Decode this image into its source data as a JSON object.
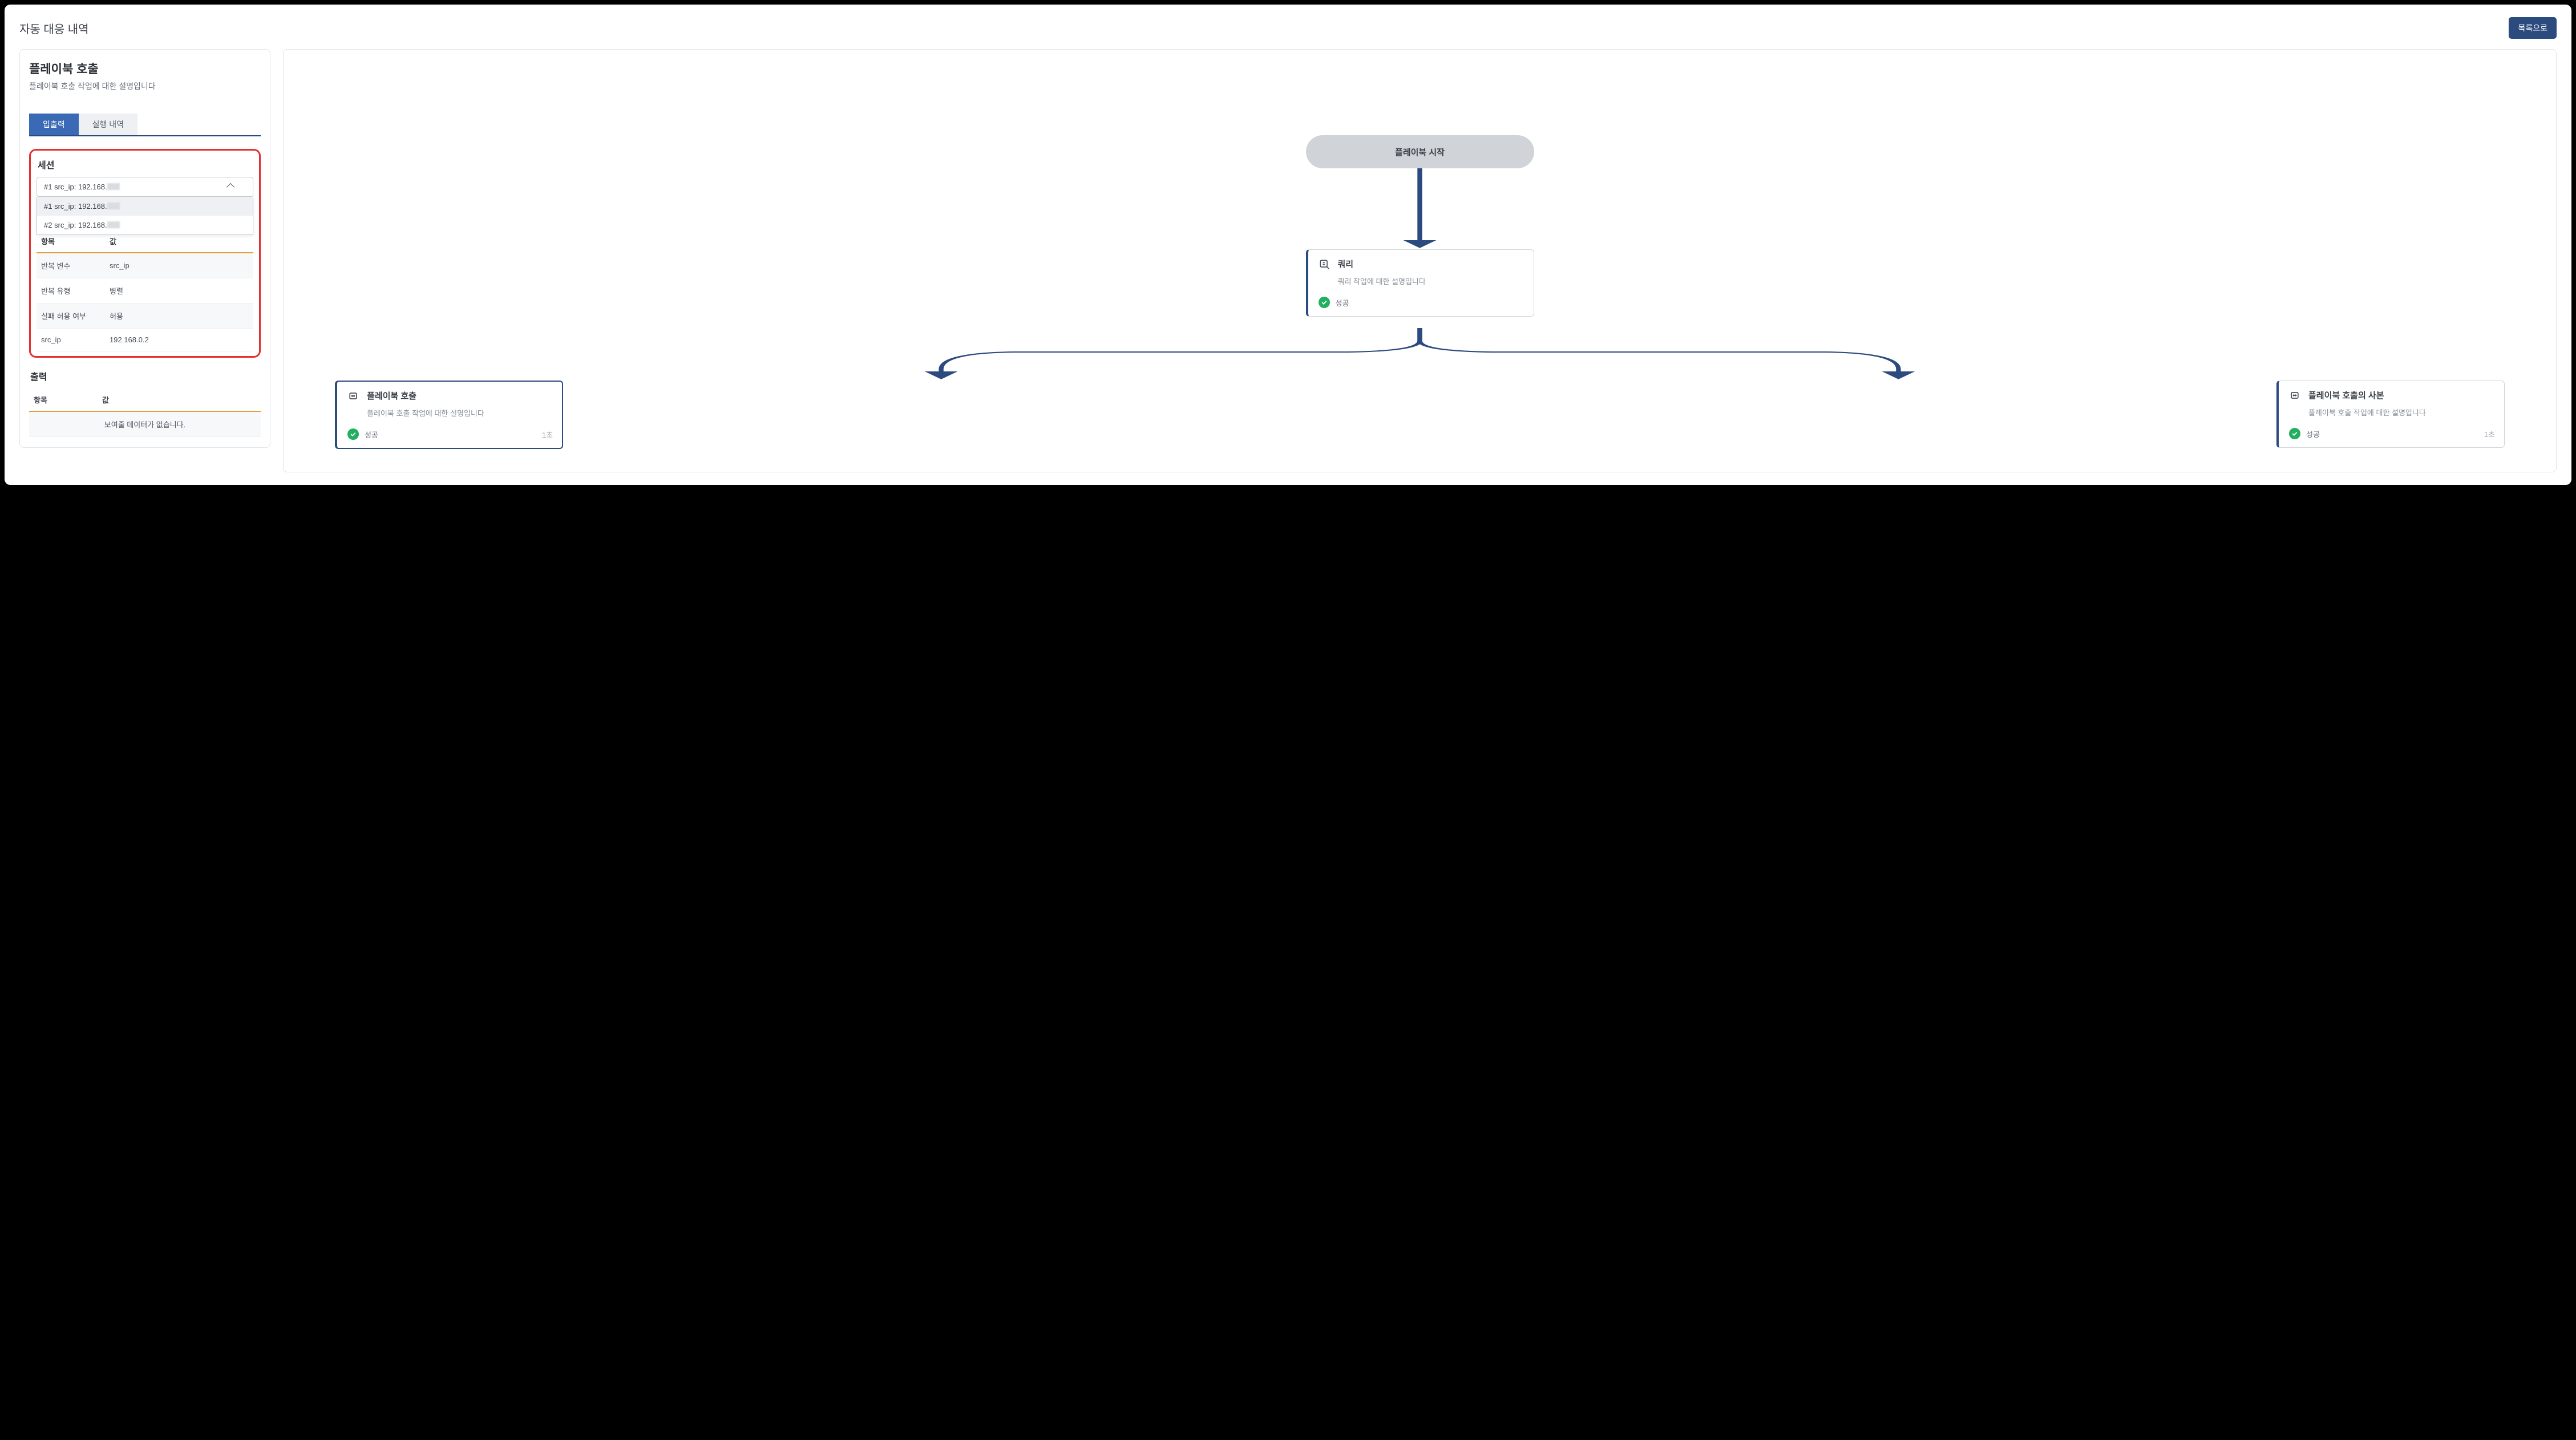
{
  "page": {
    "title": "자동 대응 내역",
    "back_button": "목록으로"
  },
  "panel": {
    "title": "플레이북 호출",
    "desc": "플레이북 호출 작업에 대한 설명입니다"
  },
  "tabs": {
    "io": "입출력",
    "history": "실행 내역"
  },
  "session": {
    "label": "세션",
    "selected": "#1 src_ip: 192.168.",
    "options": [
      "#1 src_ip: 192.168.",
      "#2 src_ip: 192.168."
    ]
  },
  "input_table": {
    "col_key": "항목",
    "col_val": "값",
    "rows": [
      {
        "k": "반복 변수",
        "v": "src_ip"
      },
      {
        "k": "반복 유형",
        "v": "병렬"
      },
      {
        "k": "실패 허용 여부",
        "v": "허용"
      },
      {
        "k": "src_ip",
        "v": "192.168.0.2"
      }
    ]
  },
  "output": {
    "label": "출력",
    "col_key": "항목",
    "col_val": "값",
    "empty": "보여줄 데이터가 없습니다."
  },
  "flow": {
    "start": "플레이북 시작",
    "query": {
      "title": "쿼리",
      "desc": "쿼리 작업에 대한 설명입니다",
      "status": "성공"
    },
    "pbcall": {
      "title": "플레이북 호출",
      "desc": "플레이북 호출 작업에 대한 설명입니다",
      "status": "성공",
      "time": "1초"
    },
    "pbcopy": {
      "title": "플레이북 호출의 사본",
      "desc": "플레이북 호출 작업에 대한 설명입니다",
      "status": "성공",
      "time": "1초"
    }
  }
}
